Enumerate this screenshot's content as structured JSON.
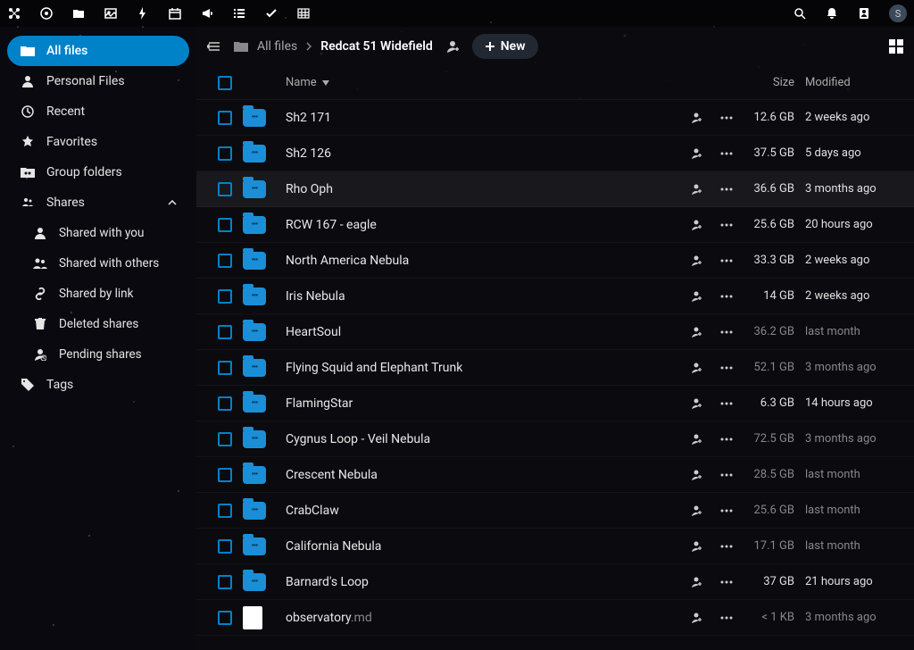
{
  "topbar": {
    "avatar_letter": "S"
  },
  "sidebar": {
    "items": [
      {
        "label": "All files",
        "active": true
      },
      {
        "label": "Personal Files"
      },
      {
        "label": "Recent"
      },
      {
        "label": "Favorites"
      },
      {
        "label": "Group folders"
      },
      {
        "label": "Shares",
        "expanded": true
      },
      {
        "label": "Shared with you",
        "sub": true
      },
      {
        "label": "Shared with others",
        "sub": true
      },
      {
        "label": "Shared by link",
        "sub": true
      },
      {
        "label": "Deleted shares",
        "sub": true
      },
      {
        "label": "Pending shares",
        "sub": true
      },
      {
        "label": "Tags"
      }
    ]
  },
  "breadcrumb": {
    "root": "All files",
    "current": "Redcat 51 Widefield"
  },
  "toolbar": {
    "new_label": "New"
  },
  "columns": {
    "name": "Name",
    "size": "Size",
    "modified": "Modified"
  },
  "files": [
    {
      "name": "Sh2 171",
      "type": "folder",
      "size": "12.6 GB",
      "modified": "2 weeks ago",
      "dim": false
    },
    {
      "name": "Sh2 126",
      "type": "folder",
      "size": "37.5 GB",
      "modified": "5 days ago",
      "dim": false
    },
    {
      "name": "Rho Oph",
      "type": "folder",
      "size": "36.6 GB",
      "modified": "3 months ago",
      "dim": false,
      "hovered": true
    },
    {
      "name": "RCW 167 - eagle",
      "type": "folder",
      "size": "25.6 GB",
      "modified": "20 hours ago",
      "dim": false
    },
    {
      "name": "North America Nebula",
      "type": "folder",
      "size": "33.3 GB",
      "modified": "2 weeks ago",
      "dim": false
    },
    {
      "name": "Iris Nebula",
      "type": "folder",
      "size": "14 GB",
      "modified": "2 weeks ago",
      "dim": false
    },
    {
      "name": "HeartSoul",
      "type": "folder",
      "size": "36.2 GB",
      "modified": "last month",
      "dim": true
    },
    {
      "name": "Flying Squid and Elephant Trunk",
      "type": "folder",
      "size": "52.1 GB",
      "modified": "3 months ago",
      "dim": true
    },
    {
      "name": "FlamingStar",
      "type": "folder",
      "size": "6.3 GB",
      "modified": "14 hours ago",
      "dim": false
    },
    {
      "name": "Cygnus Loop - Veil Nebula",
      "type": "folder",
      "size": "72.5 GB",
      "modified": "3 months ago",
      "dim": true
    },
    {
      "name": "Crescent Nebula",
      "type": "folder",
      "size": "28.5 GB",
      "modified": "last month",
      "dim": true
    },
    {
      "name": "CrabClaw",
      "type": "folder",
      "size": "25.6 GB",
      "modified": "last month",
      "dim": true
    },
    {
      "name": "California Nebula",
      "type": "folder",
      "size": "17.1 GB",
      "modified": "last month",
      "dim": true
    },
    {
      "name": "Barnard's Loop",
      "type": "folder",
      "size": "37 GB",
      "modified": "21 hours ago",
      "dim": false
    },
    {
      "name": "observatory",
      "ext": ".md",
      "type": "file",
      "size": "< 1 KB",
      "modified": "3 months ago",
      "dim": true
    }
  ]
}
